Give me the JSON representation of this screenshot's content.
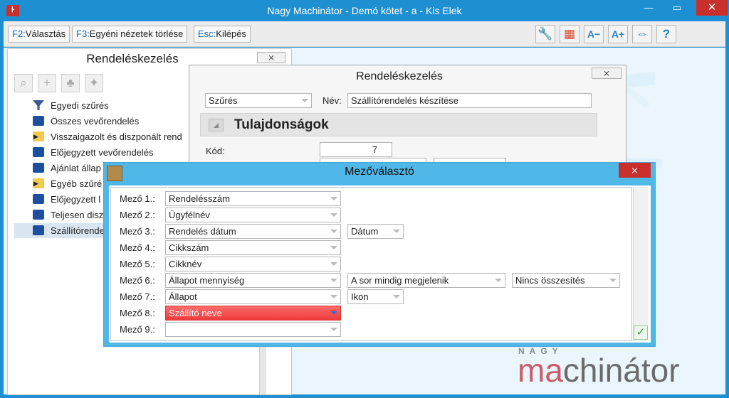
{
  "window": {
    "title": "Nagy Machinátor - Demó kötet - a - Kis Elek",
    "icon": "people-logo-icon"
  },
  "toolbar": {
    "keys": [
      {
        "key": "F2:",
        "label": "Választás"
      },
      {
        "key": "F3:",
        "label": "Egyéni nézetek törlése"
      },
      {
        "key": "Esc:",
        "label": "Kilépés"
      }
    ],
    "icons": [
      "wrench-icon",
      "grid-icon",
      "font-decrease-icon",
      "font-increase-icon",
      "arrows-horizontal-icon",
      "help-icon"
    ],
    "icon_glyphs": [
      "🔧",
      "▦",
      "A−",
      "A+",
      "⇔",
      "?"
    ]
  },
  "left_panel": {
    "title": "Rendeléskezelés",
    "close": "⨯",
    "tools": [
      "search-icon",
      "add-icon",
      "tree-icon",
      "pin-icon"
    ],
    "items": [
      {
        "label": "Egyedi szűrés",
        "icon": "filter-icon",
        "expandable": false,
        "selected": false
      },
      {
        "label": "Összes vevőrendelés",
        "icon": "computer-icon",
        "expandable": false,
        "selected": false
      },
      {
        "label": "Visszaigazolt és diszponált rend",
        "icon": "folder-icon",
        "expandable": true,
        "selected": false
      },
      {
        "label": "Előjegyzett vevőrendelés",
        "icon": "computer-icon",
        "expandable": false,
        "selected": false
      },
      {
        "label": "Ajánlat állap",
        "icon": "computer-icon",
        "expandable": false,
        "selected": false
      },
      {
        "label": "Egyéb szűré",
        "icon": "folder-icon",
        "expandable": true,
        "selected": false
      },
      {
        "label": "Előjegyzett l",
        "icon": "computer-icon",
        "expandable": false,
        "selected": false
      },
      {
        "label": "Teljesen disz",
        "icon": "computer-icon",
        "expandable": false,
        "selected": false
      },
      {
        "label": "Szállítórende",
        "icon": "computer-icon",
        "expandable": false,
        "selected": true
      }
    ]
  },
  "dialog1": {
    "title": "Rendeléskezelés",
    "close": "⨯",
    "filter_select": "Szűrés",
    "name_label": "Név:",
    "name_value": "Szállítórendelés készítése",
    "section_title": "Tulajdonságok",
    "code_label": "Kód:",
    "code_value": "7"
  },
  "dialog2": {
    "title": "Mezőválasztó",
    "close": "⨯",
    "ok": "✓",
    "fields": [
      {
        "label": "Mező  1.:",
        "value": "Rendelésszám",
        "opt1": "",
        "opt2": "",
        "highlight": false
      },
      {
        "label": "Mező  2.:",
        "value": "Ügyfélnév",
        "opt1": "",
        "opt2": "",
        "highlight": false
      },
      {
        "label": "Mező  3.:",
        "value": "Rendelés dátum",
        "opt1": "Dátum",
        "opt2": "",
        "highlight": false
      },
      {
        "label": "Mező  4.:",
        "value": "Cikkszám",
        "opt1": "",
        "opt2": "",
        "highlight": false
      },
      {
        "label": "Mező  5.:",
        "value": "Cikknév",
        "opt1": "",
        "opt2": "",
        "highlight": false
      },
      {
        "label": "Mező  6.:",
        "value": "Állapot mennyiség",
        "opt1": "A sor mindig megjelenik",
        "opt2": "Nincs összesítés",
        "highlight": false
      },
      {
        "label": "Mező  7.:",
        "value": "Állapot",
        "opt1": "Ikon",
        "opt2": "",
        "highlight": false
      },
      {
        "label": "Mező  8.:",
        "value": "Szállító neve",
        "opt1": "",
        "opt2": "",
        "highlight": true
      },
      {
        "label": "Mező  9.:",
        "value": "",
        "opt1": "",
        "opt2": "",
        "highlight": false
      }
    ]
  },
  "brand": {
    "top": "NAGY",
    "ma": "ma",
    "rest": "chinátor"
  }
}
